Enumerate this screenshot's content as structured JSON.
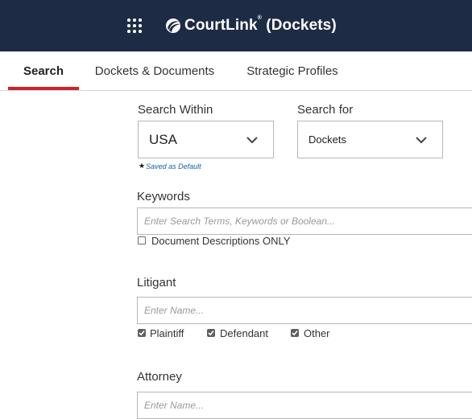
{
  "header": {
    "brand_name": "CourtLink",
    "brand_reg": "®",
    "brand_suffix": "(Dockets)",
    "apps_icon": "grid-icon",
    "logo_icon": "courtlink-swirl-logo"
  },
  "tabs": [
    {
      "label": "Search",
      "active": true
    },
    {
      "label": "Dockets & Documents",
      "active": false
    },
    {
      "label": "Strategic Profiles",
      "active": false
    }
  ],
  "colors": {
    "header_bg": "#1d2b45",
    "active_tab_underline": "#cf2129",
    "link_blue": "#1a5ea8"
  },
  "form": {
    "search_within": {
      "label": "Search Within",
      "value": "USA"
    },
    "search_for": {
      "label": "Search for",
      "value": "Dockets"
    },
    "saved_default": {
      "star": "★",
      "text": "Saved as Default"
    },
    "keywords": {
      "label": "Keywords",
      "placeholder": "Enter Search Terms, Keywords or Boolean...",
      "doc_desc_only": {
        "label": "Document Descriptions ONLY",
        "checked": false
      }
    },
    "litigant": {
      "label": "Litigant",
      "placeholder": "Enter Name...",
      "options": [
        {
          "label": "Plaintiff",
          "checked": true
        },
        {
          "label": "Defendant",
          "checked": true
        },
        {
          "label": "Other",
          "checked": true
        }
      ]
    },
    "attorney": {
      "label": "Attorney",
      "placeholder": "Enter Name..."
    }
  }
}
